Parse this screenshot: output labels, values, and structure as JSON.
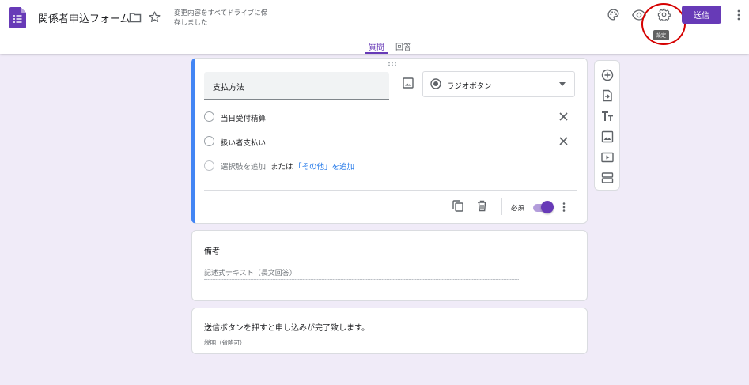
{
  "header": {
    "title": "関係者申込フォーム",
    "save_status": "変更内容をすべてドライブに保存しました",
    "tooltip": "設定",
    "send_label": "送信"
  },
  "tabs": {
    "questions": "質問",
    "responses": "回答"
  },
  "question": {
    "title": "支払方法",
    "type_label": "ラジオボタン",
    "options": [
      "当日受付精算",
      "扱い者支払い"
    ],
    "add_option": "選択肢を追加",
    "or_text": "または",
    "add_other": "「その他」を追加",
    "required_label": "必須",
    "required": true
  },
  "note_card": {
    "title": "備考",
    "placeholder": "記述式テキスト（長文回答）"
  },
  "end_card": {
    "title": "送信ボタンを押すと申し込みが完了致します。",
    "description": "説明（省略可）"
  },
  "toolbar_icons": [
    "add-circle-icon",
    "import-icon",
    "title-icon",
    "image-icon",
    "video-icon",
    "section-icon"
  ],
  "colors": {
    "accent": "#673ab7",
    "active_border": "#4285f4",
    "background": "#f0ebf8",
    "link": "#1a73e8",
    "highlight_circle": "#d50000"
  }
}
